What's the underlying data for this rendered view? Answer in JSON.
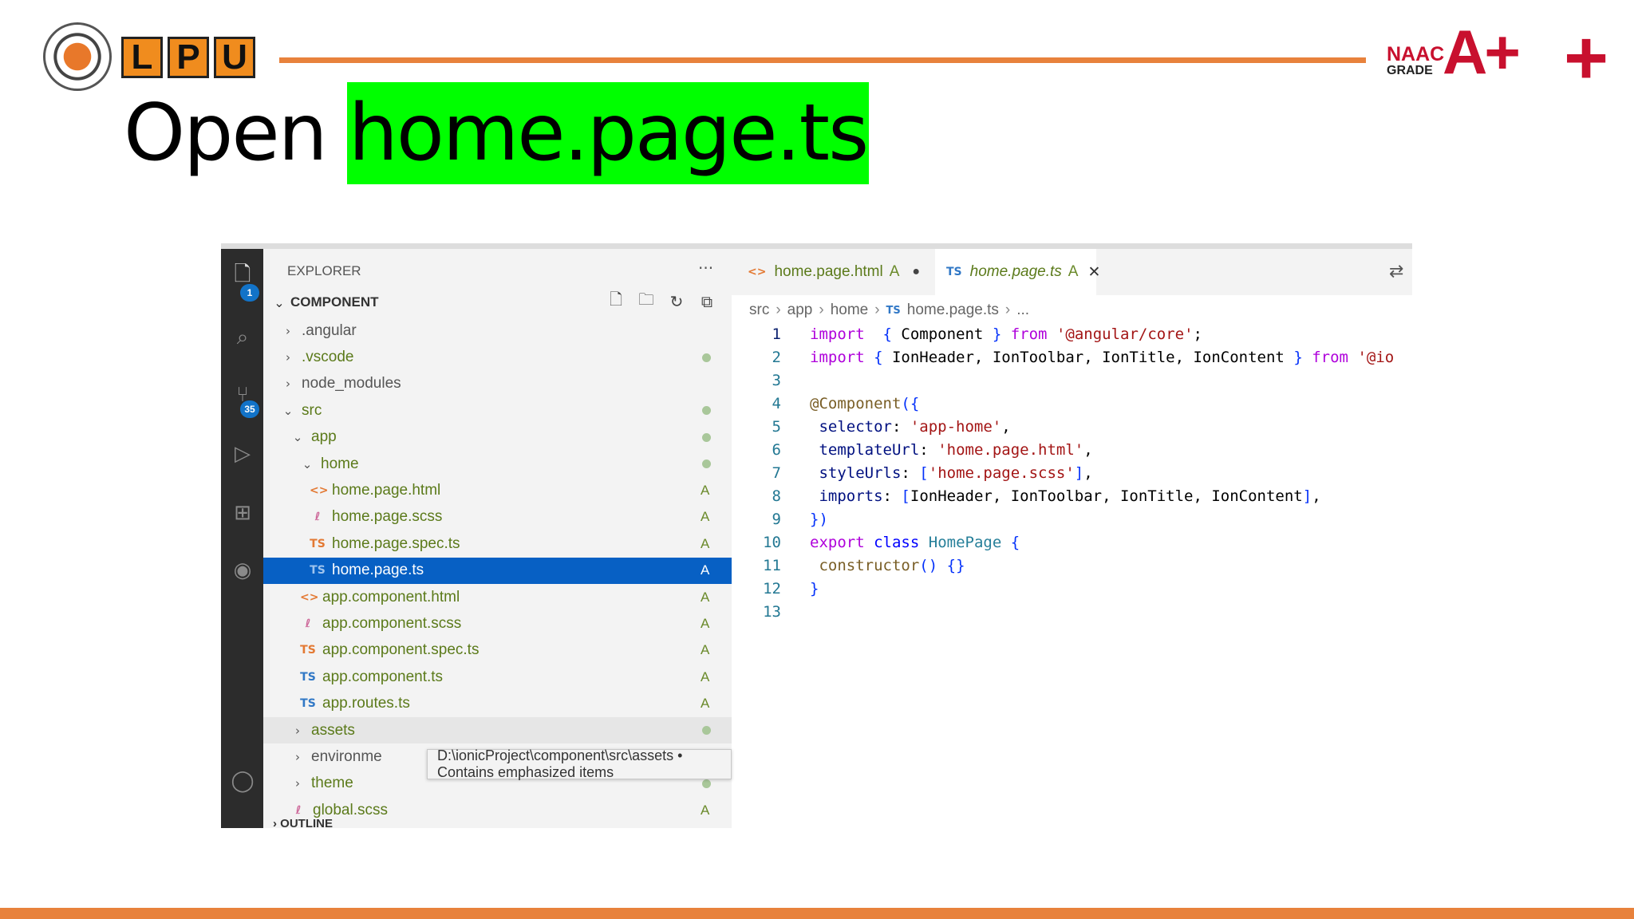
{
  "slide": {
    "logo_letters": [
      "L",
      "P",
      "U"
    ],
    "naac": {
      "top": "NAAC",
      "bottom": "GRADE",
      "grade": "A",
      "plus": "+"
    },
    "title_prefix": "Open",
    "title_highlight": "home.page.ts"
  },
  "vscode": {
    "activity_badges": {
      "explorer": "1",
      "source_control": "35"
    },
    "explorer": {
      "header": "EXPLORER",
      "more": "···",
      "folder": "COMPONENT",
      "outline": "OUTLINE",
      "tree": [
        {
          "name": ".angular",
          "depth": 0,
          "type": "folder",
          "open": false,
          "status": ""
        },
        {
          "name": ".vscode",
          "depth": 0,
          "type": "folder",
          "open": false,
          "status": "dot"
        },
        {
          "name": "node_modules",
          "depth": 0,
          "type": "folder",
          "open": false,
          "status": ""
        },
        {
          "name": "src",
          "depth": 0,
          "type": "folder",
          "open": true,
          "status": "dot"
        },
        {
          "name": "app",
          "depth": 1,
          "type": "folder",
          "open": true,
          "status": "dot"
        },
        {
          "name": "home",
          "depth": 2,
          "type": "folder",
          "open": true,
          "status": "dot"
        },
        {
          "name": "home.page.html",
          "depth": 3,
          "type": "html",
          "status": "A"
        },
        {
          "name": "home.page.scss",
          "depth": 3,
          "type": "scss",
          "status": "A"
        },
        {
          "name": "home.page.spec.ts",
          "depth": 3,
          "type": "spec",
          "status": "A"
        },
        {
          "name": "home.page.ts",
          "depth": 3,
          "type": "ts",
          "status": "A",
          "selected": true
        },
        {
          "name": "app.component.html",
          "depth": 2,
          "type": "html",
          "status": "A"
        },
        {
          "name": "app.component.scss",
          "depth": 2,
          "type": "scss",
          "status": "A"
        },
        {
          "name": "app.component.spec.ts",
          "depth": 2,
          "type": "spec",
          "status": "A"
        },
        {
          "name": "app.component.ts",
          "depth": 2,
          "type": "ts",
          "status": "A"
        },
        {
          "name": "app.routes.ts",
          "depth": 2,
          "type": "ts",
          "status": "A"
        },
        {
          "name": "assets",
          "depth": 1,
          "type": "folder",
          "open": false,
          "status": "dot",
          "hover": true
        },
        {
          "name": "environme",
          "depth": 1,
          "type": "folder",
          "open": false,
          "status": ""
        },
        {
          "name": "theme",
          "depth": 1,
          "type": "folder",
          "open": false,
          "status": "dot"
        },
        {
          "name": "global.scss",
          "depth": 1,
          "type": "scss",
          "status": "A"
        }
      ],
      "tooltip": "D:\\ionicProject\\component\\src\\assets • Contains emphasized items"
    },
    "tabs": [
      {
        "label": "home.page.html",
        "status": "A",
        "icon": "<>",
        "dirty": "●"
      },
      {
        "label": "home.page.ts",
        "status": "A",
        "icon": "TS",
        "close": "✕"
      }
    ],
    "breadcrumbs": [
      "src",
      "app",
      "home",
      "home.page.ts",
      "..."
    ],
    "breadcrumb_ts_icon": "TS",
    "code_lines": [
      {
        "n": "1",
        "tokens": [
          [
            "kw",
            "import"
          ],
          [
            "",
            "  "
          ],
          [
            "br",
            "{"
          ],
          [
            "",
            " Component "
          ],
          [
            "br",
            "}"
          ],
          [
            "",
            " "
          ],
          [
            "kw",
            "from"
          ],
          [
            "",
            " "
          ],
          [
            "str",
            "'@angular/core'"
          ],
          [
            "",
            ";"
          ]
        ]
      },
      {
        "n": "2",
        "tokens": [
          [
            "kw",
            "import"
          ],
          [
            "",
            " "
          ],
          [
            "br",
            "{"
          ],
          [
            "",
            " IonHeader, IonToolbar, IonTitle, IonContent "
          ],
          [
            "br",
            "}"
          ],
          [
            "",
            " "
          ],
          [
            "kw",
            "from"
          ],
          [
            "",
            " "
          ],
          [
            "str",
            "'@io"
          ]
        ]
      },
      {
        "n": "3",
        "tokens": []
      },
      {
        "n": "4",
        "tokens": [
          [
            "dec",
            "@Component"
          ],
          [
            "br",
            "({"
          ]
        ]
      },
      {
        "n": "5",
        "tokens": [
          [
            "",
            " "
          ],
          [
            "id",
            "selector"
          ],
          [
            "",
            ": "
          ],
          [
            "str",
            "'app-home'"
          ],
          [
            "",
            ","
          ]
        ]
      },
      {
        "n": "6",
        "tokens": [
          [
            "",
            " "
          ],
          [
            "id",
            "templateUrl"
          ],
          [
            "",
            ": "
          ],
          [
            "str",
            "'home.page.html'"
          ],
          [
            "",
            ","
          ]
        ]
      },
      {
        "n": "7",
        "tokens": [
          [
            "",
            " "
          ],
          [
            "id",
            "styleUrls"
          ],
          [
            "",
            ": "
          ],
          [
            "br",
            "["
          ],
          [
            "str",
            "'home.page.scss'"
          ],
          [
            "br",
            "]"
          ],
          [
            "",
            ","
          ]
        ]
      },
      {
        "n": "8",
        "tokens": [
          [
            "",
            " "
          ],
          [
            "id",
            "imports"
          ],
          [
            "",
            ": "
          ],
          [
            "br",
            "["
          ],
          [
            "",
            "IonHeader, IonToolbar, IonTitle, IonContent"
          ],
          [
            "br",
            "]"
          ],
          [
            "",
            ","
          ]
        ]
      },
      {
        "n": "9",
        "tokens": [
          [
            "br",
            "})"
          ]
        ]
      },
      {
        "n": "10",
        "tokens": [
          [
            "kw",
            "export"
          ],
          [
            "",
            " "
          ],
          [
            "kb",
            "class"
          ],
          [
            "",
            " "
          ],
          [
            "cls",
            "HomePage"
          ],
          [
            "",
            " "
          ],
          [
            "br",
            "{"
          ]
        ]
      },
      {
        "n": "11",
        "tokens": [
          [
            "",
            " "
          ],
          [
            "dec",
            "constructor"
          ],
          [
            "br",
            "()"
          ],
          [
            "",
            " "
          ],
          [
            "br",
            "{}"
          ]
        ]
      },
      {
        "n": "12",
        "tokens": [
          [
            "br",
            "}"
          ]
        ]
      },
      {
        "n": "13",
        "tokens": []
      }
    ]
  },
  "colors": {
    "accent_orange": "#e8823c",
    "highlight_green": "#00ff00",
    "selection_blue": "#0760c4"
  }
}
